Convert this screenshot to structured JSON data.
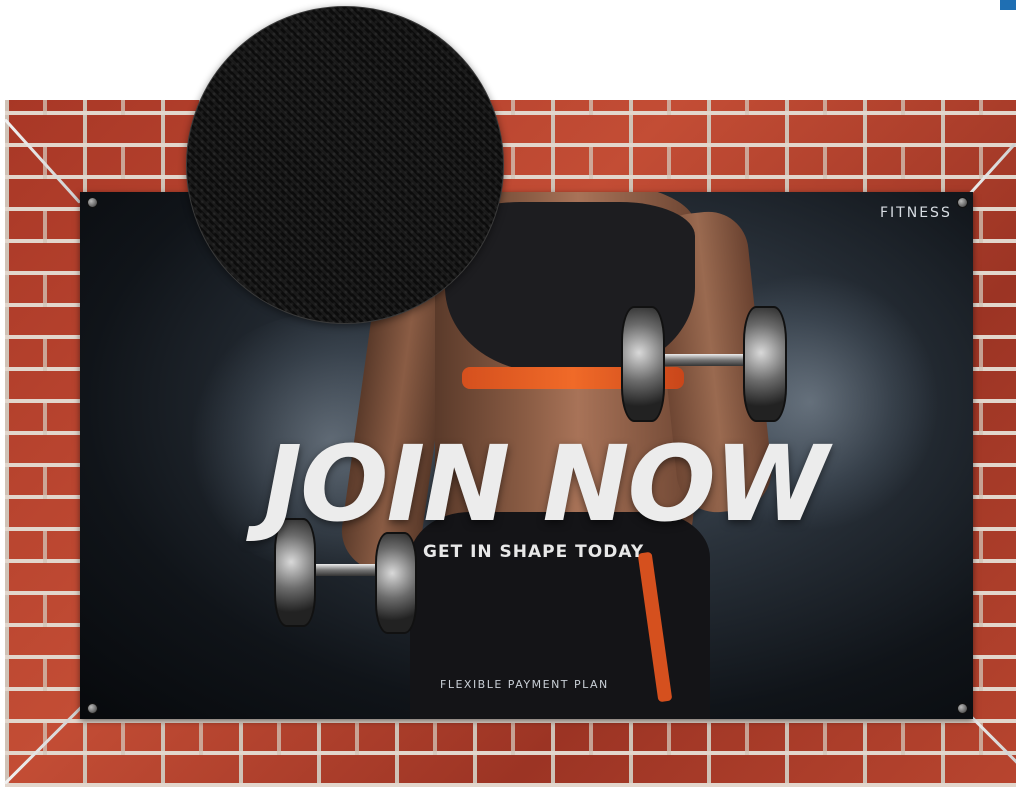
{
  "banner": {
    "brand": "FITNESS",
    "headline": "JOIN NOW",
    "subheadline": "GET IN SHAPE TODAY",
    "footer": "FLEXIBLE PAYMENT PLAN"
  },
  "colors": {
    "brick": "#b5402f",
    "mortar": "#e2d6cc",
    "banner_background": "#101419",
    "accent_orange": "#f06a28",
    "headline_text": "#ececec",
    "corner_badge": "#1f6fb3"
  },
  "icons": {
    "material_swatch": "fabric-texture-swatch"
  }
}
